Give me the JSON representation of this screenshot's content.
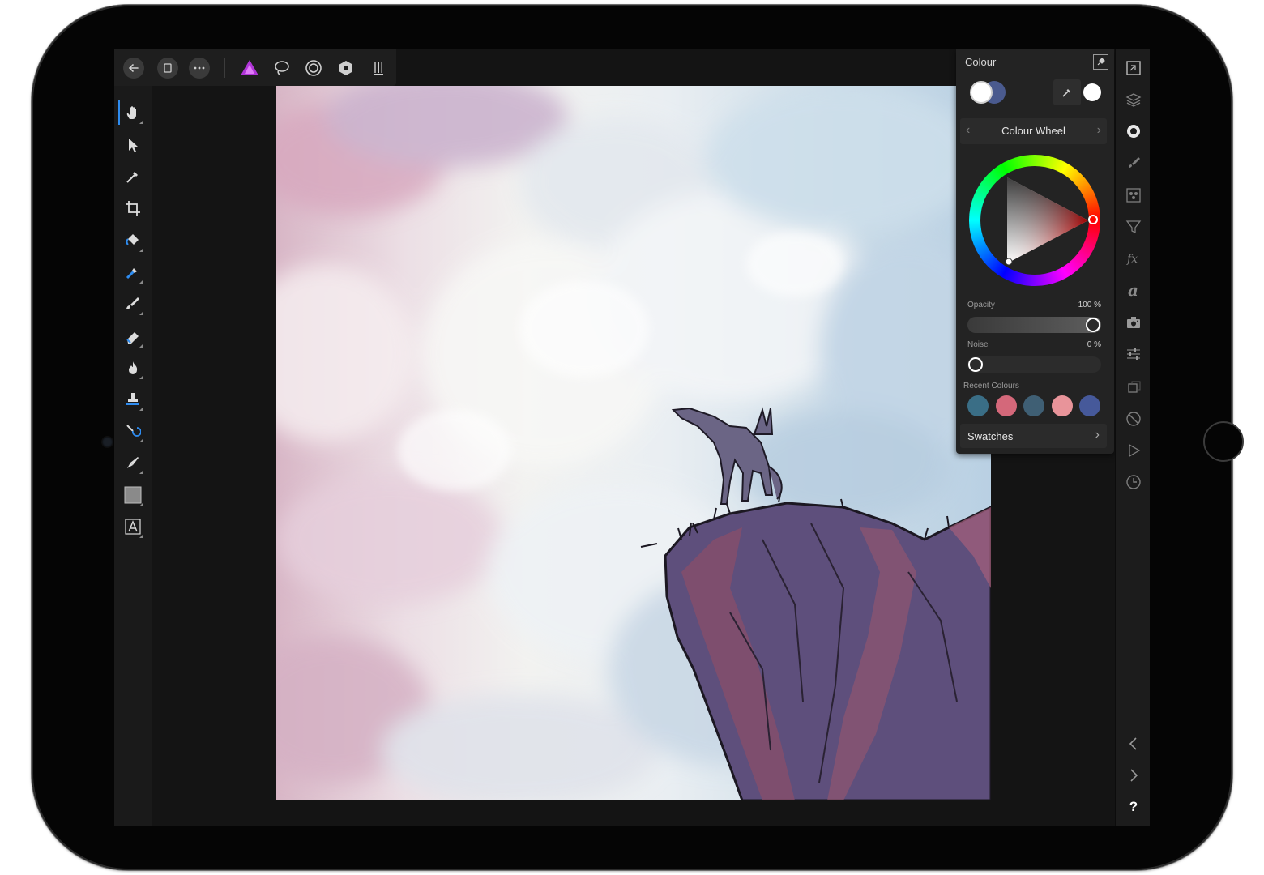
{
  "colour_panel": {
    "title": "Colour",
    "mode": "Colour Wheel",
    "primary_colour": "#ffffff",
    "secondary_colour": "#4a5a8e",
    "opacity_label": "Opacity",
    "opacity_value": "100 %",
    "opacity_fraction": 1.0,
    "noise_label": "Noise",
    "noise_value": "0 %",
    "noise_fraction": 0.0,
    "recent_label": "Recent Colours",
    "recent_colours": [
      "#3a6e86",
      "#d4687a",
      "#3f5f74",
      "#e8949a",
      "#46599a"
    ],
    "swatches_label": "Swatches"
  },
  "theme": {
    "accent": "#2e8cf0",
    "persona_accent": "#c03fe0"
  },
  "studio": {
    "help_label": "?"
  }
}
